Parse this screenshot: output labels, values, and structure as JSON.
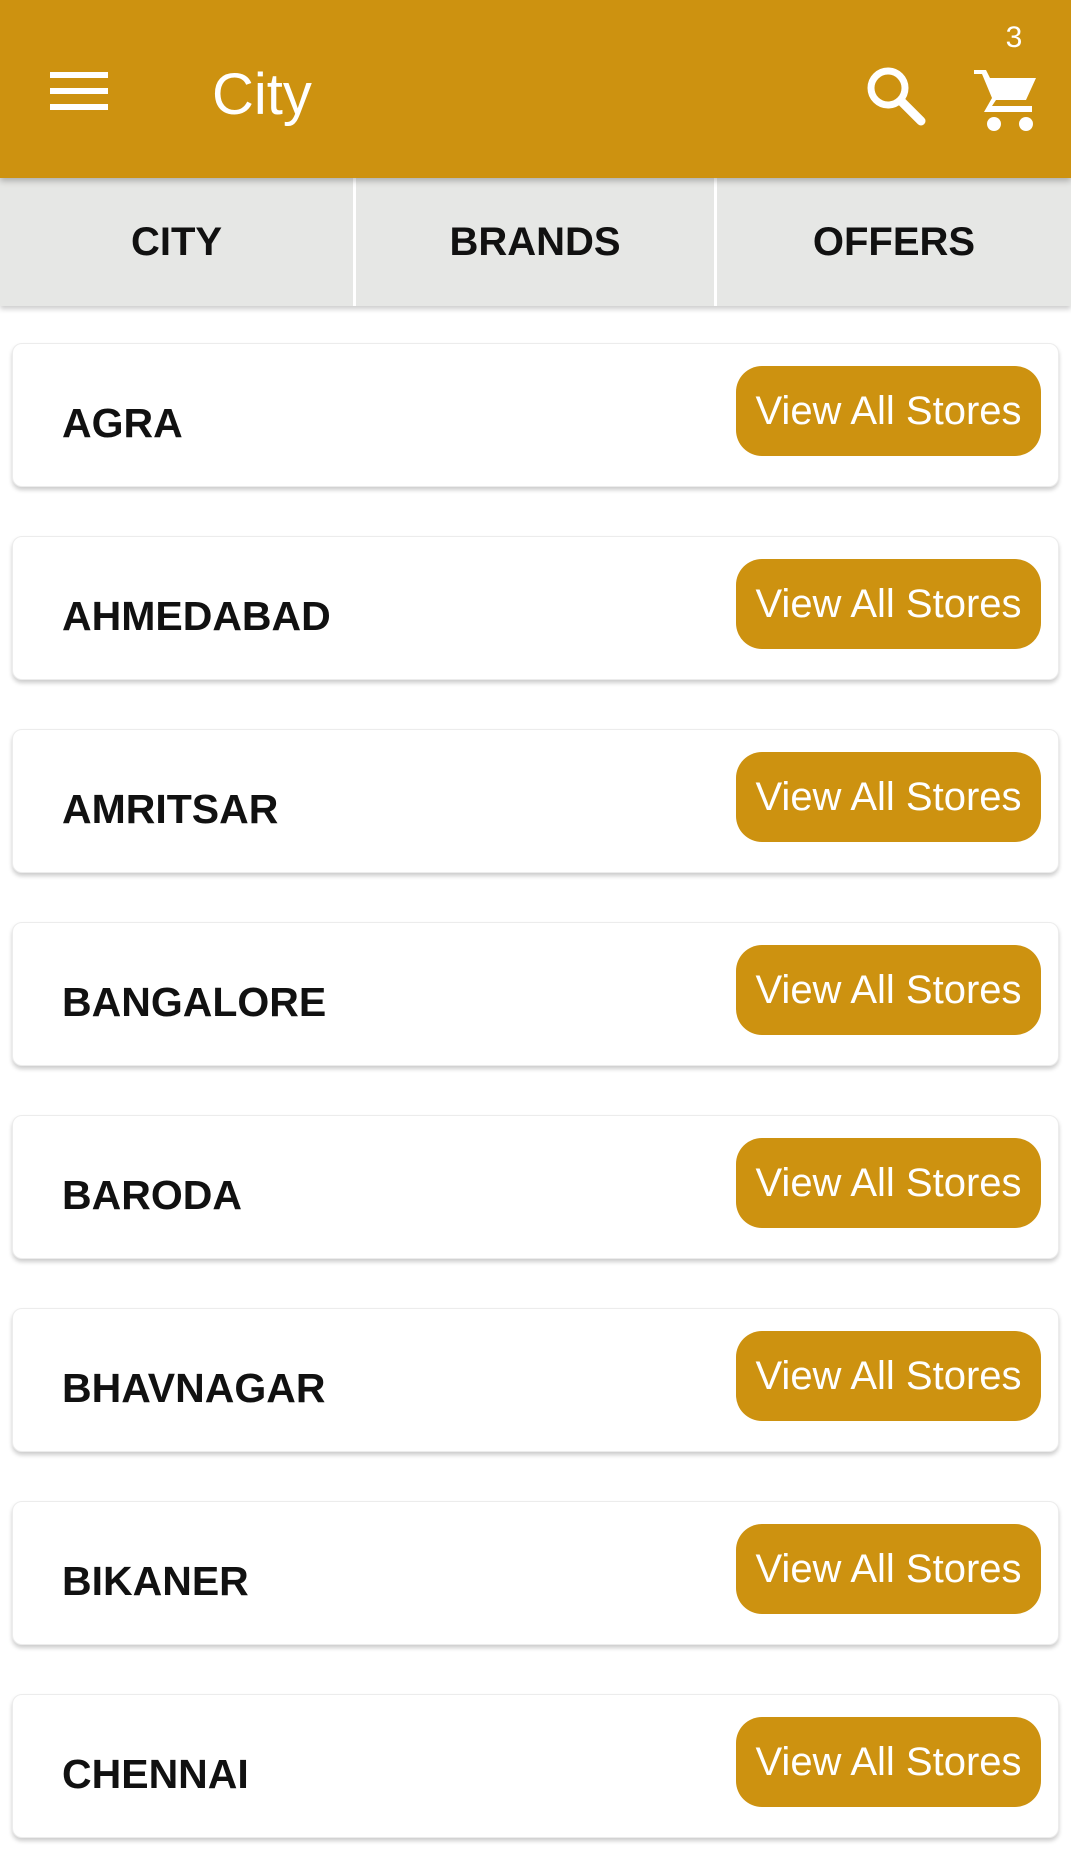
{
  "colors": {
    "primary": "#CD9210",
    "tab_background": "#E6E7E5",
    "card_background": "#FFFFFF",
    "text_dark": "#111111"
  },
  "header": {
    "title": "City",
    "menu_icon": "hamburger-menu-icon",
    "search_icon": "search-icon",
    "cart_icon": "shopping-cart-icon",
    "cart_count": "3"
  },
  "tabs": [
    {
      "label": "CITY"
    },
    {
      "label": "BRANDS"
    },
    {
      "label": "OFFERS"
    }
  ],
  "cities": [
    {
      "name": "AGRA",
      "button": "View All Stores"
    },
    {
      "name": "AHMEDABAD",
      "button": "View All Stores"
    },
    {
      "name": "AMRITSAR",
      "button": "View All Stores"
    },
    {
      "name": "BANGALORE",
      "button": "View All Stores"
    },
    {
      "name": "BARODA",
      "button": "View All Stores"
    },
    {
      "name": "BHAVNAGAR",
      "button": "View All Stores"
    },
    {
      "name": "BIKANER",
      "button": "View All Stores"
    },
    {
      "name": "CHENNAI",
      "button": "View All Stores"
    }
  ]
}
